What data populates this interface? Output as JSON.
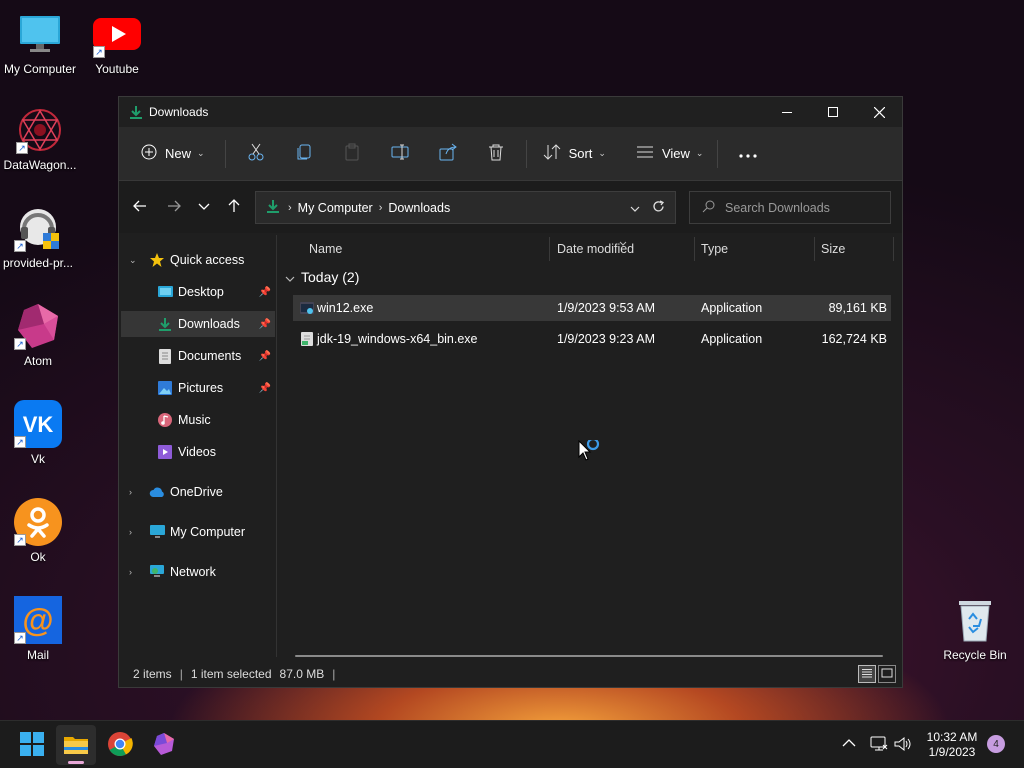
{
  "desktop": {
    "icons": [
      {
        "label": "My Computer",
        "icon": "monitor-icon"
      },
      {
        "label": "Youtube",
        "icon": "youtube-icon"
      },
      {
        "label": "DataWagon...",
        "icon": "datawagon-icon"
      },
      {
        "label": "provided-pr...",
        "icon": "headset-icon"
      },
      {
        "label": "Atom",
        "icon": "atom-icon"
      },
      {
        "label": "Vk",
        "icon": "vk-icon"
      },
      {
        "label": "Ok",
        "icon": "ok-icon"
      },
      {
        "label": "Mail",
        "icon": "mail-icon"
      },
      {
        "label": "Recycle Bin",
        "icon": "recycle-bin-icon"
      }
    ]
  },
  "window": {
    "title": "Downloads",
    "toolbar": {
      "new_label": "New",
      "sort_label": "Sort",
      "view_label": "View"
    },
    "breadcrumb": [
      "My Computer",
      "Downloads"
    ],
    "search": {
      "placeholder": "Search Downloads"
    },
    "sidebar": {
      "quick_access": "Quick access",
      "items": [
        {
          "label": "Desktop",
          "pinned": true
        },
        {
          "label": "Downloads",
          "pinned": true,
          "selected": true
        },
        {
          "label": "Documents",
          "pinned": true
        },
        {
          "label": "Pictures",
          "pinned": true
        },
        {
          "label": "Music",
          "pinned": false
        },
        {
          "label": "Videos",
          "pinned": false
        }
      ],
      "onedrive": "OneDrive",
      "my_computer": "My Computer",
      "network": "Network"
    },
    "columns": [
      "Name",
      "Date modified",
      "Type",
      "Size"
    ],
    "group_label": "Today (2)",
    "files": [
      {
        "name": "win12.exe",
        "date": "1/9/2023 9:53 AM",
        "type": "Application",
        "size": "89,161 KB",
        "selected": true
      },
      {
        "name": "jdk-19_windows-x64_bin.exe",
        "date": "1/9/2023 9:23 AM",
        "type": "Application",
        "size": "162,724 KB",
        "selected": false
      }
    ],
    "status": {
      "items": "2 items",
      "selected": "1 item selected",
      "selected_size": "87.0 MB"
    }
  },
  "taskbar": {
    "clock_time": "10:32 AM",
    "clock_date": "1/9/2023",
    "notification_count": "4"
  },
  "colors": {
    "accent": "#1f9e6b",
    "selection": "#383838",
    "window_bg": "#1f1f1f"
  }
}
